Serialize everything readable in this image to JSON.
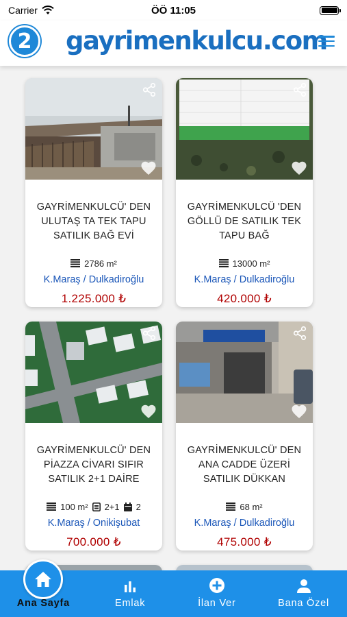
{
  "status": {
    "carrier": "Carrier",
    "time": "ÖÖ 11:05"
  },
  "header": {
    "brand": "gayrimenkulcu.com",
    "logo_glyph": "2"
  },
  "listings": [
    {
      "title": "GAYRİMENKULCÜ' DEN ULUTAŞ TA TEK TAPU SATILIK BAĞ EVİ",
      "area": "2786 m²",
      "location": "K.Maraş / Dulkadiroğlu",
      "price": "1.225.000 ₺"
    },
    {
      "title": "GAYRİMENKULCÜ 'DEN GÖLLÜ DE SATILIK TEK TAPU BAĞ",
      "area": "13000 m²",
      "location": "K.Maraş / Dulkadiroğlu",
      "price": "420.000 ₺"
    },
    {
      "title": "GAYRİMENKULCÜ' DEN PİAZZA CİVARI SIFIR SATILIK 2+1 DAİRE",
      "area": "100 m²",
      "rooms": "2+1",
      "floor": "2",
      "location": "K.Maraş / Onikişubat",
      "price": "700.000 ₺"
    },
    {
      "title": "GAYRİMENKULCÜ' DEN ANA CADDE ÜZERİ SATILIK DÜKKAN",
      "area": "68 m²",
      "location": "K.Maraş / Dulkadiroğlu",
      "price": "475.000 ₺"
    }
  ],
  "tabs": [
    {
      "label": "Ana Sayfa",
      "icon": "home-icon"
    },
    {
      "label": "Emlak",
      "icon": "bar-chart-icon"
    },
    {
      "label": "İlan Ver",
      "icon": "add-circle-icon"
    },
    {
      "label": "Bana Özel",
      "icon": "person-icon"
    }
  ],
  "colors": {
    "accent": "#1e90e8",
    "brand": "#1a6fc0",
    "price": "#b00000",
    "location": "#1a56b8"
  }
}
